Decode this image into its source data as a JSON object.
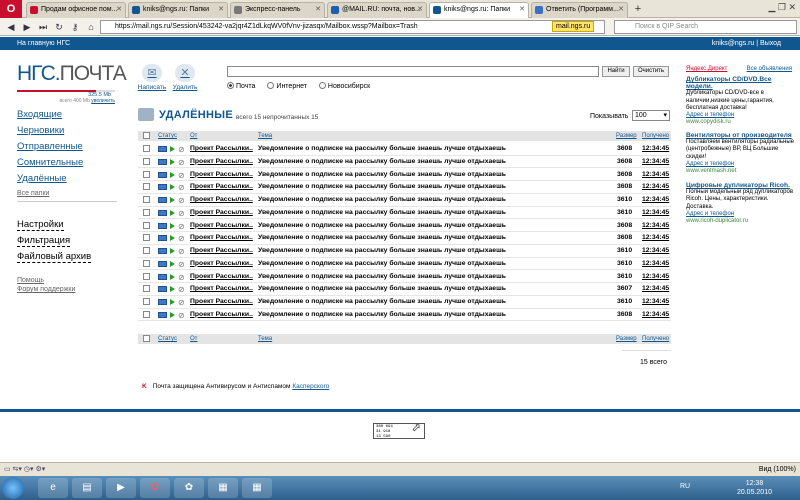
{
  "browser": {
    "opera_logo": "O",
    "tabs": [
      {
        "label": "Продам офисное пом...",
        "active": false,
        "favicon_color": "#c8102e"
      },
      {
        "label": "kniks@ngs.ru: Папки",
        "active": false,
        "favicon_color": "#11578f"
      },
      {
        "label": "Экспресс-панель",
        "active": false,
        "favicon_color": "#777777"
      },
      {
        "label": "@MAIL.RU: почта, нов...",
        "active": false,
        "favicon_color": "#1a5fb4"
      },
      {
        "label": "kniks@ngs.ru: Папки",
        "active": true,
        "favicon_color": "#11578f"
      },
      {
        "label": "Ответить (Программ...",
        "active": false,
        "favicon_color": "#3b6fc4"
      }
    ],
    "new_tab": "+",
    "url": "https://mail.ngs.ru/Session/453242-va2jqr4Z1dLkqWV0fVnv-jizasqx/Mailbox.wssp?Mailbox=Trash",
    "site_badge": "mail.ngs.ru",
    "search_placeholder": "Поиск в QIP Search"
  },
  "header": {
    "home_link": "На главную НГС",
    "user": "kniks@ngs.ru",
    "logout": "Выход"
  },
  "sidebar": {
    "logo_ngs": "НГС.",
    "logo_mail": "ПОЧТА",
    "quota_used": "325.5 Mb",
    "quota_total": "всего 400 Mb",
    "quota_increase": "увеличить",
    "quota_fraction": 0.81,
    "folders": [
      {
        "label": "Входящие"
      },
      {
        "label": "Черновики"
      },
      {
        "label": "Отправленные"
      },
      {
        "label": "Сомнительные"
      },
      {
        "label": "Удалённые"
      }
    ],
    "all_folders": "Все папки",
    "settings": "Настройки",
    "filtering": "Фильтрация",
    "file_archive": "Файловый архив",
    "help": "Помощь",
    "support": "Форум поддержки"
  },
  "toolbar": {
    "write": "Написать",
    "delete": "Удалить",
    "search_value": "",
    "find_button": "Найти",
    "clear_button": "Очистить",
    "scope_options": [
      "Почта",
      "Интернет",
      "Новосибирск"
    ],
    "scope_selected": "Почта"
  },
  "folder_view": {
    "title": "УДАЛЁННЫЕ",
    "summary": "всего 15 непрочитанных 15",
    "show_label": "Показывать",
    "show_value": "100",
    "columns": {
      "status": "Статус",
      "from": "От",
      "subject": "Тема",
      "size": "Размер",
      "received": "Получено"
    },
    "rows": [
      {
        "from": "Проект Рассылки..",
        "subject": "Уведомление о подписке на рассылку больше знаешь лучше отдыхаешь",
        "size": "3608",
        "time": "12:34:45"
      },
      {
        "from": "Проект Рассылки..",
        "subject": "Уведомление о подписке на рассылку больше знаешь лучше отдыхаешь",
        "size": "3608",
        "time": "12:34:45"
      },
      {
        "from": "Проект Рассылки..",
        "subject": "Уведомление о подписке на рассылку больше знаешь лучше отдыхаешь",
        "size": "3608",
        "time": "12:34:45"
      },
      {
        "from": "Проект Рассылки..",
        "subject": "Уведомление о подписке на рассылку больше знаешь лучше отдыхаешь",
        "size": "3608",
        "time": "12:34:45"
      },
      {
        "from": "Проект Рассылки..",
        "subject": "Уведомление о подписке на рассылку больше знаешь лучше отдыхаешь",
        "size": "3610",
        "time": "12:34:45"
      },
      {
        "from": "Проект Рассылки..",
        "subject": "Уведомление о подписке на рассылку больше знаешь лучше отдыхаешь",
        "size": "3610",
        "time": "12:34:45"
      },
      {
        "from": "Проект Рассылки..",
        "subject": "Уведомление о подписке на рассылку больше знаешь лучше отдыхаешь",
        "size": "3608",
        "time": "12:34:45"
      },
      {
        "from": "Проект Рассылки..",
        "subject": "Уведомление о подписке на рассылку больше знаешь лучше отдыхаешь",
        "size": "3608",
        "time": "12:34:45"
      },
      {
        "from": "Проект Рассылки..",
        "subject": "Уведомление о подписке на рассылку больше знаешь лучше отдыхаешь",
        "size": "3610",
        "time": "12:34:45"
      },
      {
        "from": "Проект Рассылки..",
        "subject": "Уведомление о подписке на рассылку больше знаешь лучше отдыхаешь",
        "size": "3610",
        "time": "12:34:45"
      },
      {
        "from": "Проект Рассылки..",
        "subject": "Уведомление о подписке на рассылку больше знаешь лучше отдыхаешь",
        "size": "3610",
        "time": "12:34:45"
      },
      {
        "from": "Проект Рассылки..",
        "subject": "Уведомление о подписке на рассылку больше знаешь лучше отдыхаешь",
        "size": "3607",
        "time": "12:34:45"
      },
      {
        "from": "Проект Рассылки..",
        "subject": "Уведомление о подписке на рассылку больше знаешь лучше отдыхаешь",
        "size": "3610",
        "time": "12:34:45"
      },
      {
        "from": "Проект Рассылки..",
        "subject": "Уведомление о подписке на рассылку больше знаешь лучше отдыхаешь",
        "size": "3608",
        "time": "12:34:45"
      }
    ],
    "total": "15 всего",
    "antivirus_text": "Почта защищена Антивирусом и Антиспамом",
    "antivirus_link": "Касперского"
  },
  "ads": {
    "brand": "Яндекс.Директ",
    "all_ads": "Все объявления",
    "items": [
      {
        "title": "Дубликаторы CD/DVD.Все модели.",
        "text": "Дубликаторы CD/DVD-все в наличии,низкие цены,гарантия, бесплатная доставка!",
        "contact": "Адрес и телефон",
        "url": "www.copydisk.ru"
      },
      {
        "title": "Вентиляторы от производителя",
        "text": "Поставляем вентиляторы радиальные (центробежные) ВР, ВЦ Большие скидки!",
        "contact": "Адрес и телефон",
        "url": "www.ventmash.net"
      },
      {
        "title": "Цифровые дупликаторы Ricoh.",
        "text": "Полный модельный ряд дупликаторов Ricoh. Цены, характеристики. Доставка.",
        "contact": "Адрес и телефон",
        "url": "www.ricoh-duplicator.ru"
      }
    ]
  },
  "counter": {
    "line1": "380 094",
    "line2": "31 918",
    "line3": "13 590"
  },
  "statusbar": {
    "zoom": "Вид (100%)"
  },
  "taskbar": {
    "lang": "RU",
    "time": "12:38",
    "date": "20.05.2010"
  }
}
